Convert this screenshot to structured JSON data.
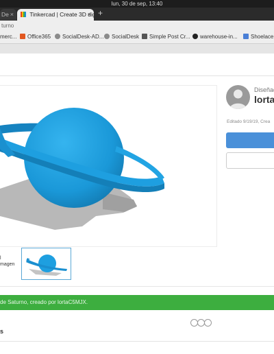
{
  "system": {
    "clock": "lun, 30 de sep, 13:40"
  },
  "tabs": [
    {
      "label": "De",
      "close": "×"
    },
    {
      "label": "Tinkercad | Create 3D digi",
      "close": "×"
    }
  ],
  "newtab_label": "+",
  "urlbar": {
    "text": "turno"
  },
  "bookmarks": [
    {
      "label": "merc...",
      "icon": "folder-icon",
      "color": "#6a6a6a"
    },
    {
      "label": "Office365",
      "icon": "office-icon",
      "color": "#e2571f"
    },
    {
      "label": "SocialDesk-AD...",
      "icon": "globe-icon",
      "color": "#8a8a8a"
    },
    {
      "label": "SocialDesk",
      "icon": "globe-icon",
      "color": "#8a8a8a"
    },
    {
      "label": "Simple Post Cr...",
      "icon": "n-icon",
      "color": "#555555"
    },
    {
      "label": "warehouse-in...",
      "icon": "github-icon",
      "color": "#222222"
    },
    {
      "label": "Shoelace -",
      "icon": "grid-icon",
      "color": "#4a7fd6"
    }
  ],
  "designer": {
    "designed_label": "Diseñad",
    "author": "lorta",
    "edited": "Editado 9/19/19, Crea"
  },
  "thumbnails": {
    "left_label_line1": "l",
    "left_label_line2": "magen"
  },
  "banner": {
    "text": "de Saturno, creado por lortaC5MJX."
  },
  "bottom": {
    "label": "s"
  },
  "colors": {
    "accent": "#4a90d9",
    "banner": "#3dae3f",
    "planet": "#1e9fe0"
  }
}
